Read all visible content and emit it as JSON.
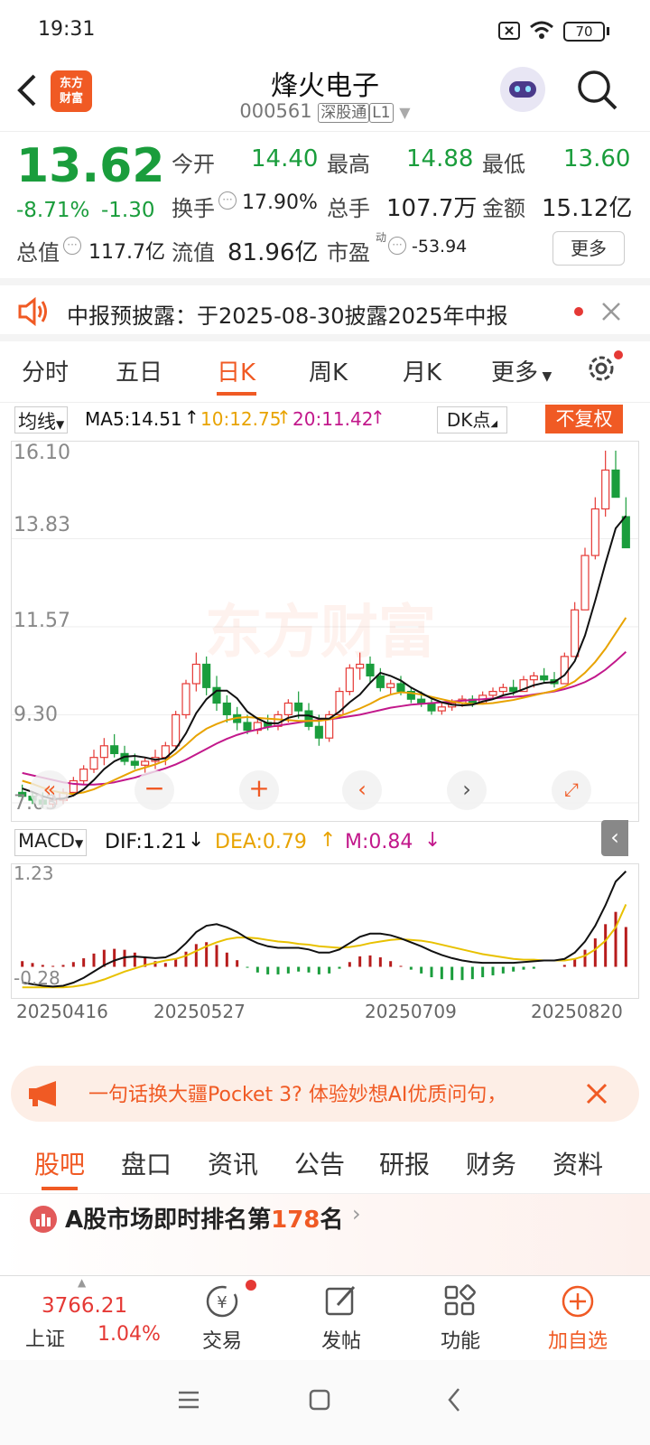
{
  "status": {
    "time": "19:31",
    "battery": "70"
  },
  "header": {
    "back_icon": "chevron-left-icon",
    "logo_text": "东方\n财富",
    "title": "烽火电子",
    "code": "000561",
    "exchange_tag": "深股通",
    "level_tag": "L1"
  },
  "quote": {
    "price": "13.62",
    "change_pct": "-8.71%",
    "change": "-1.30",
    "open_label": "今开",
    "open": "14.40",
    "high_label": "最高",
    "high": "14.88",
    "low_label": "最低",
    "low": "13.60",
    "turnover_label": "换手",
    "turnover": "17.90%",
    "volume_label": "总手",
    "volume": "107.7万",
    "amount_label": "金额",
    "amount": "15.12亿",
    "mktcap_label": "总值",
    "mktcap": "117.7亿",
    "float_label": "流值",
    "float_cap": "81.96亿",
    "pe_label": "市盈",
    "pe_sup": "动",
    "pe": "-53.94",
    "more_label": "更多"
  },
  "notice": {
    "text": "中报预披露：于2025-08-30披露2025年中报"
  },
  "chart_tabs": [
    "分时",
    "五日",
    "日K",
    "周K",
    "月K",
    "更多"
  ],
  "chart_tabs_active": 2,
  "indicators": {
    "selector": "均线",
    "ma5": "MA5:14.51",
    "ma10": "10:12.75",
    "ma20": "20:11.42",
    "dk": "DK点",
    "adjust": "不复权",
    "watermark": "东方财富"
  },
  "chart_data": {
    "type": "candlestick",
    "y_ticks": [
      "16.10",
      "13.83",
      "11.57",
      "9.30",
      "7.03"
    ],
    "ylim": [
      7.03,
      16.1
    ],
    "x_labels": [
      "20250416",
      "20250527",
      "20250709",
      "20250820"
    ],
    "ohlc": [
      [
        7.3,
        7.5,
        7.1,
        7.2
      ],
      [
        7.2,
        7.3,
        7.0,
        7.1
      ],
      [
        7.1,
        7.3,
        6.9,
        7.0
      ],
      [
        7.0,
        7.2,
        6.9,
        7.1
      ],
      [
        7.1,
        7.4,
        7.0,
        7.3
      ],
      [
        7.3,
        7.7,
        7.2,
        7.6
      ],
      [
        7.6,
        8.0,
        7.5,
        7.9
      ],
      [
        7.9,
        8.4,
        7.8,
        8.2
      ],
      [
        8.2,
        8.7,
        8.0,
        8.5
      ],
      [
        8.5,
        8.8,
        8.2,
        8.3
      ],
      [
        8.3,
        8.5,
        8.0,
        8.1
      ],
      [
        8.1,
        8.3,
        7.9,
        8.0
      ],
      [
        8.0,
        8.2,
        7.8,
        8.1
      ],
      [
        8.1,
        8.4,
        7.9,
        8.2
      ],
      [
        8.2,
        8.6,
        8.0,
        8.5
      ],
      [
        8.5,
        9.4,
        8.4,
        9.3
      ],
      [
        9.3,
        10.2,
        9.2,
        10.1
      ],
      [
        10.1,
        10.9,
        9.9,
        10.6
      ],
      [
        10.6,
        10.8,
        9.8,
        10.0
      ],
      [
        10.0,
        10.3,
        9.4,
        9.6
      ],
      [
        9.6,
        9.8,
        9.1,
        9.3
      ],
      [
        9.3,
        9.5,
        8.9,
        9.1
      ],
      [
        9.1,
        9.3,
        8.8,
        8.9
      ],
      [
        8.9,
        9.2,
        8.8,
        9.1
      ],
      [
        9.1,
        9.3,
        8.9,
        9.0
      ],
      [
        9.0,
        9.4,
        8.9,
        9.3
      ],
      [
        9.3,
        9.7,
        9.1,
        9.6
      ],
      [
        9.6,
        9.9,
        9.2,
        9.4
      ],
      [
        9.4,
        9.6,
        8.9,
        9.0
      ],
      [
        9.0,
        9.3,
        8.5,
        8.7
      ],
      [
        8.7,
        9.4,
        8.6,
        9.3
      ],
      [
        9.3,
        10.0,
        9.2,
        9.9
      ],
      [
        9.9,
        10.6,
        9.8,
        10.5
      ],
      [
        10.5,
        10.9,
        10.2,
        10.6
      ],
      [
        10.6,
        10.8,
        10.1,
        10.3
      ],
      [
        10.3,
        10.5,
        9.9,
        10.0
      ],
      [
        10.0,
        10.2,
        9.8,
        10.1
      ],
      [
        10.1,
        10.3,
        9.8,
        9.9
      ],
      [
        9.9,
        10.0,
        9.6,
        9.7
      ],
      [
        9.7,
        9.9,
        9.5,
        9.6
      ],
      [
        9.6,
        9.7,
        9.3,
        9.4
      ],
      [
        9.4,
        9.6,
        9.3,
        9.5
      ],
      [
        9.5,
        9.7,
        9.4,
        9.6
      ],
      [
        9.6,
        9.8,
        9.5,
        9.7
      ],
      [
        9.7,
        9.8,
        9.5,
        9.6
      ],
      [
        9.6,
        9.9,
        9.6,
        9.8
      ],
      [
        9.8,
        10.0,
        9.7,
        9.9
      ],
      [
        9.9,
        10.1,
        9.8,
        10.0
      ],
      [
        10.0,
        10.2,
        9.8,
        9.9
      ],
      [
        9.9,
        10.3,
        9.9,
        10.2
      ],
      [
        10.2,
        10.4,
        10.0,
        10.3
      ],
      [
        10.3,
        10.5,
        10.1,
        10.2
      ],
      [
        10.2,
        10.4,
        10.0,
        10.1
      ],
      [
        10.1,
        10.9,
        10.1,
        10.8
      ],
      [
        10.8,
        12.2,
        10.8,
        12.0
      ],
      [
        12.0,
        13.6,
        12.0,
        13.4
      ],
      [
        13.4,
        14.9,
        13.3,
        14.6
      ],
      [
        14.6,
        16.1,
        14.4,
        15.6
      ],
      [
        15.6,
        16.1,
        14.9,
        14.9
      ],
      [
        14.4,
        14.9,
        13.6,
        13.6
      ]
    ],
    "ma5": [
      7.4,
      7.31,
      7.2,
      7.13,
      7.14,
      7.22,
      7.38,
      7.62,
      7.9,
      8.1,
      8.22,
      8.24,
      8.2,
      8.14,
      8.18,
      8.42,
      8.82,
      9.34,
      9.7,
      9.92,
      9.92,
      9.72,
      9.38,
      9.2,
      9.08,
      9.08,
      9.22,
      9.28,
      9.28,
      9.2,
      9.2,
      9.38,
      9.62,
      9.82,
      10.12,
      10.38,
      10.3,
      10.18,
      10.0,
      9.86,
      9.72,
      9.62,
      9.56,
      9.54,
      9.56,
      9.64,
      9.7,
      9.8,
      9.86,
      9.96,
      10.06,
      10.12,
      10.14,
      10.32,
      10.68,
      11.34,
      12.24,
      13.2,
      14.1,
      14.42
    ],
    "ma10": [
      7.6,
      7.52,
      7.42,
      7.34,
      7.28,
      7.26,
      7.3,
      7.38,
      7.5,
      7.62,
      7.74,
      7.86,
      7.94,
      8.02,
      8.12,
      8.3,
      8.52,
      8.76,
      8.94,
      9.06,
      9.16,
      9.22,
      9.24,
      9.22,
      9.2,
      9.18,
      9.16,
      9.14,
      9.14,
      9.14,
      9.18,
      9.26,
      9.36,
      9.46,
      9.58,
      9.72,
      9.82,
      9.88,
      9.86,
      9.82,
      9.76,
      9.7,
      9.64,
      9.6,
      9.58,
      9.58,
      9.6,
      9.64,
      9.68,
      9.74,
      9.8,
      9.86,
      9.92,
      10.02,
      10.16,
      10.38,
      10.66,
      11.0,
      11.4,
      11.8
    ],
    "ma20": [
      7.8,
      7.74,
      7.68,
      7.62,
      7.56,
      7.52,
      7.5,
      7.5,
      7.52,
      7.56,
      7.62,
      7.68,
      7.76,
      7.84,
      7.92,
      8.02,
      8.14,
      8.28,
      8.42,
      8.56,
      8.68,
      8.78,
      8.86,
      8.92,
      8.98,
      9.02,
      9.06,
      9.1,
      9.14,
      9.16,
      9.18,
      9.22,
      9.26,
      9.3,
      9.36,
      9.42,
      9.48,
      9.52,
      9.56,
      9.58,
      9.6,
      9.62,
      9.64,
      9.66,
      9.68,
      9.7,
      9.72,
      9.74,
      9.76,
      9.78,
      9.82,
      9.86,
      9.9,
      9.96,
      10.04,
      10.14,
      10.28,
      10.46,
      10.68,
      10.92
    ]
  },
  "macd": {
    "selector": "MACD",
    "dif": "DIF:1.21",
    "dea": "DEA:0.79",
    "m": "M:0.84",
    "y_ticks": [
      "1.23",
      "-0.28"
    ]
  },
  "macd_data": {
    "ylim": [
      -0.28,
      1.23
    ],
    "dif": [
      -0.2,
      -0.22,
      -0.24,
      -0.25,
      -0.24,
      -0.2,
      -0.14,
      -0.06,
      0.02,
      0.08,
      0.12,
      0.13,
      0.12,
      0.11,
      0.12,
      0.18,
      0.3,
      0.44,
      0.52,
      0.54,
      0.5,
      0.44,
      0.36,
      0.3,
      0.26,
      0.24,
      0.24,
      0.24,
      0.22,
      0.18,
      0.18,
      0.22,
      0.3,
      0.38,
      0.42,
      0.42,
      0.4,
      0.36,
      0.31,
      0.26,
      0.2,
      0.15,
      0.11,
      0.08,
      0.06,
      0.05,
      0.05,
      0.05,
      0.05,
      0.06,
      0.07,
      0.08,
      0.08,
      0.1,
      0.18,
      0.32,
      0.52,
      0.78,
      1.08,
      1.21
    ],
    "dea": [
      -0.26,
      -0.26,
      -0.26,
      -0.26,
      -0.26,
      -0.25,
      -0.23,
      -0.2,
      -0.16,
      -0.11,
      -0.06,
      -0.02,
      0.02,
      0.05,
      0.08,
      0.1,
      0.14,
      0.2,
      0.26,
      0.31,
      0.35,
      0.37,
      0.37,
      0.36,
      0.34,
      0.32,
      0.31,
      0.29,
      0.28,
      0.26,
      0.25,
      0.24,
      0.25,
      0.27,
      0.3,
      0.32,
      0.34,
      0.35,
      0.34,
      0.33,
      0.31,
      0.28,
      0.25,
      0.22,
      0.19,
      0.16,
      0.14,
      0.12,
      0.1,
      0.09,
      0.09,
      0.08,
      0.08,
      0.08,
      0.1,
      0.14,
      0.22,
      0.33,
      0.5,
      0.79
    ]
  },
  "x_axis": [
    "20250416",
    "20250527",
    "20250709",
    "20250820"
  ],
  "ad": {
    "text": "一句话换大疆Pocket 3? 体验妙想AI优质问句，"
  },
  "info_tabs": [
    "股吧",
    "盘口",
    "资讯",
    "公告",
    "研报",
    "财务",
    "资料"
  ],
  "ranking": {
    "prefix": "A股市场即时排名第",
    "rank": "178",
    "suffix": "名"
  },
  "index": {
    "value": "3766.21",
    "name": "上证",
    "change": "1.04%"
  },
  "nav": {
    "trade": "交易",
    "post": "发帖",
    "func": "功能",
    "add": "加自选"
  }
}
